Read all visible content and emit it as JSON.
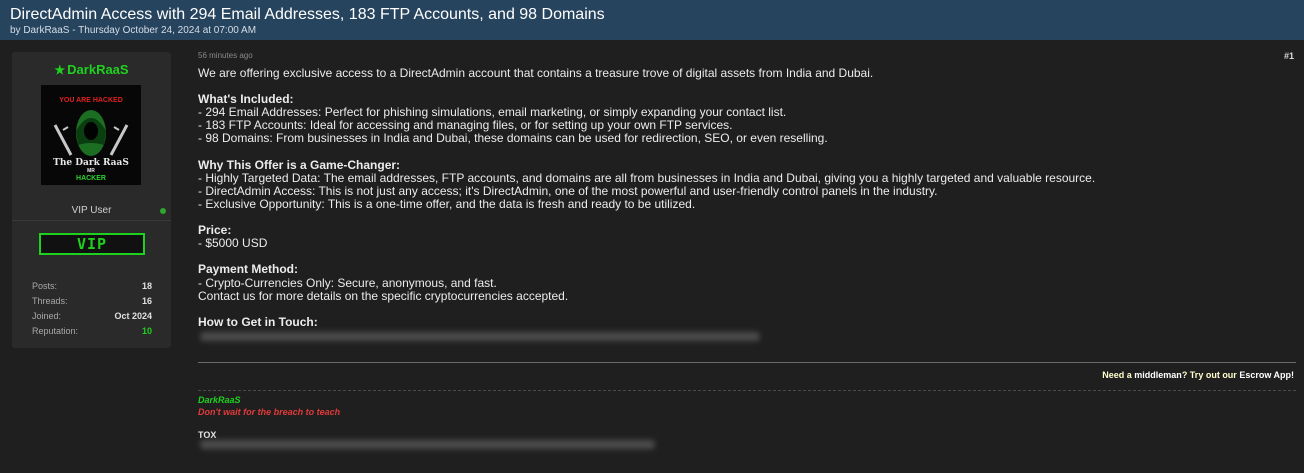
{
  "thread": {
    "title": "DirectAdmin Access with 294 Email Addresses, 183 FTP Accounts, and 98 Domains",
    "meta": "by DarkRaaS - Thursday October 24, 2024 at 07:00 AM"
  },
  "user": {
    "name": "DarkRaaS",
    "role": "VIP User",
    "badge": "VIP",
    "avatar_text": {
      "top": "YOU ARE HACKED",
      "middle": "The Dark RaaS",
      "small": "MR",
      "bottom": "HACKER"
    },
    "stats": [
      {
        "label": "Posts:",
        "value": "18"
      },
      {
        "label": "Threads:",
        "value": "16"
      },
      {
        "label": "Joined:",
        "value": "Oct 2024"
      },
      {
        "label": "Reputation:",
        "value": "10"
      }
    ]
  },
  "post": {
    "time": "56 minutes ago",
    "number": "#1",
    "intro": "We are offering exclusive access to a DirectAdmin account that contains a treasure trove of digital assets from India and Dubai.",
    "included_heading": "What's Included:",
    "included": [
      "- 294 Email Addresses: Perfect for phishing simulations, email marketing, or simply expanding your contact list.",
      "- 183 FTP Accounts: Ideal for accessing and managing files, or for setting up your own FTP services.",
      "- 98 Domains: From businesses in India and Dubai, these domains can be used for redirection, SEO, or even reselling."
    ],
    "why_heading": "Why This Offer is a Game-Changer:",
    "why": [
      "- Highly Targeted Data: The email addresses, FTP accounts, and domains are all from businesses in India and Dubai, giving you a highly targeted and valuable resource.",
      "- DirectAdmin Access: This is not just any access; it's DirectAdmin, one of the most powerful and user-friendly control panels in the industry.",
      "- Exclusive Opportunity: This is a one-time offer, and the data is fresh and ready to be utilized."
    ],
    "price_heading": "Price:",
    "price": "- $5000 USD",
    "payment_heading": "Payment Method:",
    "payment": [
      "- Crypto-Currencies Only: Secure, anonymous, and fast.",
      "Contact us for more details on the specific cryptocurrencies accepted."
    ],
    "contact_heading": "How to Get in Touch:"
  },
  "escrow": {
    "prefix": "Need a ",
    "middleman": "middleman",
    "middle": "? Try out our ",
    "app": "Escrow App!"
  },
  "signature": {
    "name": "DarkRaaS",
    "motto": "Don't wait for the breach to teach",
    "tox_label": "TOX"
  },
  "colors": {
    "titlebar": "#27445f",
    "username": "#1fd11f",
    "motto": "#e23a3a",
    "background": "#1f1f1f"
  }
}
